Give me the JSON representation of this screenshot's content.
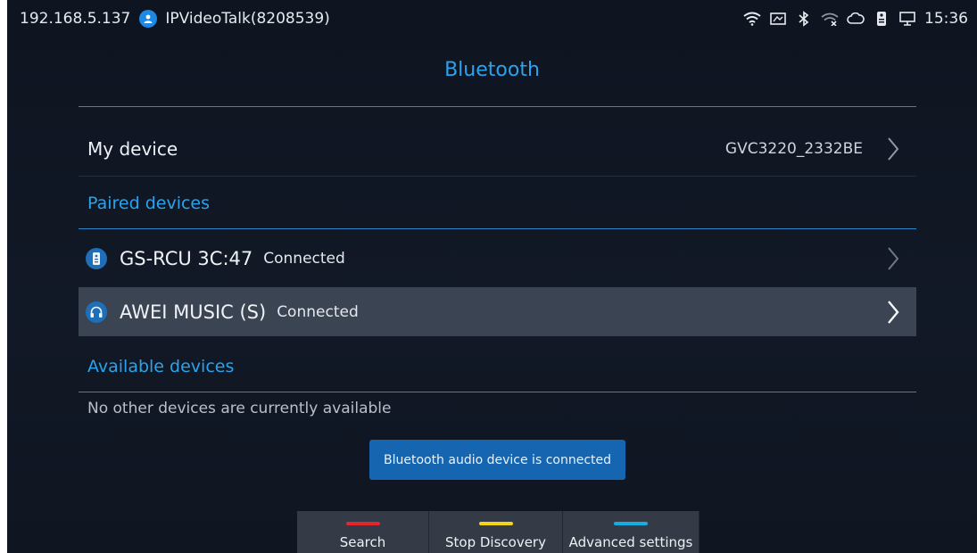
{
  "status_bar": {
    "ip": "192.168.5.137",
    "account": "IPVideoTalk(8208539)",
    "time": "15:36",
    "icons": [
      "wifi-icon",
      "screen-icon",
      "bluetooth-icon",
      "wifi-off-icon",
      "cloud-icon",
      "remote-icon",
      "monitor-icon"
    ]
  },
  "page": {
    "title": "Bluetooth"
  },
  "my_device": {
    "label": "My device",
    "value": "GVC3220_2332BE"
  },
  "paired": {
    "title": "Paired devices",
    "devices": [
      {
        "name": "GS-RCU 3C:47",
        "status": "Connected",
        "icon": "remote-control-icon"
      },
      {
        "name": "AWEI MUSIC (S)",
        "status": "Connected",
        "icon": "headphones-icon"
      }
    ]
  },
  "available": {
    "title": "Available devices",
    "empty": "No other devices are currently available"
  },
  "toast": "Bluetooth audio device is connected",
  "softkeys": [
    {
      "label": "Search",
      "color": "#e3262e"
    },
    {
      "label": "Stop Discovery",
      "color": "#f2d516"
    },
    {
      "label": "Advanced settings",
      "color": "#14aee3"
    }
  ],
  "colors": {
    "accent": "#2aa3ec",
    "toast_bg": "#1565b0",
    "selected_row": "#3a4453"
  }
}
